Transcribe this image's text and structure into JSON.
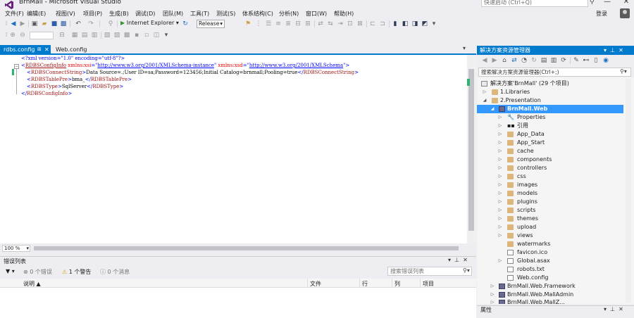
{
  "window": {
    "title": "BrnMall - Microsoft Visual Studio",
    "quick_launch_placeholder": "快速启动 (Ctrl+Q)",
    "login": "登录"
  },
  "menu": [
    "文件(F)",
    "编辑(E)",
    "视图(V)",
    "项目(P)",
    "生成(B)",
    "调试(D)",
    "团队(M)",
    "工具(T)",
    "测试(S)",
    "体系结构(C)",
    "分析(N)",
    "窗口(W)",
    "帮助(H)"
  ],
  "toolbar": {
    "run_label": "Internet Explorer",
    "configuration": "Release"
  },
  "tabs": [
    {
      "label": "rdbs.config",
      "active": true
    },
    {
      "label": "Web.config",
      "active": false
    }
  ],
  "editor": {
    "zoom": "100 %",
    "lines": [
      {
        "pi": "<?xml version=\"1.0\" encoding=\"utf-8\"?>"
      },
      {
        "open": "<",
        "tag": "RDBSConfigInfo",
        "attr1": " xmlns:xsi",
        "eq1": "=\"",
        "url1": "http://www.w3.org/2001/XMLSchema-instance",
        "q1": "\"",
        "attr2": " xmlns:xsd",
        "eq2": "=\"",
        "url2": "http://www.w3.org/2001/XMLSchema",
        "q2": "\"",
        "close": ">"
      },
      {
        "open": "<",
        "tag": "RDBSConnectString",
        "close": ">",
        "text": "Data Source=.;User ID=sa;Password=123456;Initial Catalog=brnmall;Pooling=true",
        "end_open": "</",
        "end_tag": "RDBSConnectString",
        "end_close": ">"
      },
      {
        "open": "<",
        "tag": "RDBSTablePre",
        "close": ">",
        "text": "bma_",
        "end_open": "</",
        "end_tag": "RDBSTablePre",
        "end_close": ">"
      },
      {
        "open": "<",
        "tag": "RDBSType",
        "close": ">",
        "text": "SqlServer",
        "end_open": "</",
        "end_tag": "RDBSType",
        "end_close": ">"
      },
      {
        "end_open": "</",
        "end_tag": "RDBSConfigInfo",
        "end_close": ">"
      }
    ]
  },
  "error_list": {
    "title": "错误列表",
    "errors": "0 个错误",
    "warnings": "1 个警告",
    "messages": "0 个消息",
    "search_placeholder": "搜索错误列表",
    "columns": [
      "说明",
      "文件",
      "行",
      "列",
      "项目"
    ]
  },
  "solution_explorer": {
    "title": "解决方案资源管理器",
    "search_placeholder": "搜索解决方案资源管理器(Ctrl+;)",
    "solution": "解决方案'BrnMall' (29 个项目)",
    "nodes": [
      "1.Libraries",
      "2.Presentation",
      "BrnMall.Web",
      "Properties",
      "引用",
      "App_Data",
      "App_Start",
      "cache",
      "components",
      "controllers",
      "css",
      "images",
      "models",
      "plugins",
      "scripts",
      "themes",
      "upload",
      "views",
      "watermarks",
      "favicon.ico",
      "Global.asax",
      "robots.txt",
      "Web.config",
      "BrnMall.Web.Framework",
      "BrnMall.Web.MallAdmin",
      "BrnMall.Web.MallZ..."
    ]
  },
  "properties": {
    "title": "属性"
  }
}
